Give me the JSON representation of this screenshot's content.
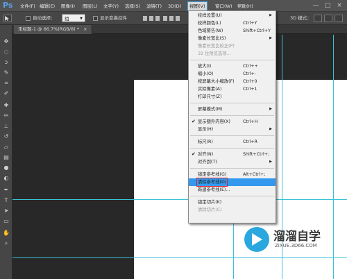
{
  "app": {
    "logo": "Ps"
  },
  "menubar": {
    "items": [
      "文件(F)",
      "编辑(E)",
      "图像(I)",
      "图层(L)",
      "文字(Y)",
      "选择(S)",
      "滤镜(T)",
      "3D(D)",
      "视图(V)",
      "窗口(W)",
      "帮助(H)"
    ],
    "active_index": 8
  },
  "options_bar": {
    "auto_select_label": "自动选择：",
    "auto_select_value": "组",
    "show_transform_label": "显示变换控件",
    "mode_3d_label": "3D 模式："
  },
  "document_tab": {
    "title": "未标题-1 @ 66.7%(RGB/8) *",
    "close": "×"
  },
  "window_controls": [
    "—",
    "□",
    "×"
  ],
  "view_menu": {
    "items": [
      {
        "label": "校样设置(U)",
        "shortcut": "",
        "submenu": true,
        "disabled": false
      },
      {
        "label": "校样颜色(L)",
        "shortcut": "Ctrl+Y",
        "submenu": false,
        "disabled": false
      },
      {
        "label": "色域警告(W)",
        "shortcut": "Shift+Ctrl+Y",
        "submenu": false,
        "disabled": false
      },
      {
        "label": "像素长宽比(S)",
        "shortcut": "",
        "submenu": true,
        "disabled": false
      },
      {
        "label": "像素长宽比校正(P)",
        "shortcut": "",
        "submenu": false,
        "disabled": true
      },
      {
        "label": "32 位预览选项...",
        "shortcut": "",
        "submenu": false,
        "disabled": true
      },
      {
        "label": "放大(I)",
        "shortcut": "Ctrl++",
        "submenu": false,
        "disabled": false
      },
      {
        "label": "缩小(O)",
        "shortcut": "Ctrl+-",
        "submenu": false,
        "disabled": false
      },
      {
        "label": "按屏幕大小缩放(F)",
        "shortcut": "Ctrl+0",
        "submenu": false,
        "disabled": false
      },
      {
        "label": "实际像素(A)",
        "shortcut": "Ctrl+1",
        "submenu": false,
        "disabled": false
      },
      {
        "label": "打印尺寸(Z)",
        "shortcut": "",
        "submenu": false,
        "disabled": false
      },
      {
        "label": "屏幕模式(M)",
        "shortcut": "",
        "submenu": true,
        "disabled": false
      },
      {
        "label": "显示额外内容(X)",
        "shortcut": "Ctrl+H",
        "submenu": false,
        "disabled": false,
        "checked": true
      },
      {
        "label": "显示(H)",
        "shortcut": "",
        "submenu": true,
        "disabled": false
      },
      {
        "label": "标尺(R)",
        "shortcut": "Ctrl+R",
        "submenu": false,
        "disabled": false
      },
      {
        "label": "对齐(N)",
        "shortcut": "Shift+Ctrl+;",
        "submenu": false,
        "disabled": false,
        "checked": true
      },
      {
        "label": "对齐到(T)",
        "shortcut": "",
        "submenu": true,
        "disabled": false
      },
      {
        "label": "锁定参考线(G)",
        "shortcut": "Alt+Ctrl+;",
        "submenu": false,
        "disabled": false
      },
      {
        "label": "清除参考线(D)",
        "shortcut": "",
        "submenu": false,
        "disabled": false,
        "highlighted": true
      },
      {
        "label": "新建参考线(E)...",
        "shortcut": "",
        "submenu": false,
        "disabled": false
      },
      {
        "label": "锁定切片(K)",
        "shortcut": "",
        "submenu": false,
        "disabled": false
      },
      {
        "label": "清除切片(C)",
        "shortcut": "",
        "submenu": false,
        "disabled": true
      }
    ]
  },
  "watermark": {
    "title": "溜溜自学",
    "url": "ZIXUE.3D66.COM"
  },
  "colors": {
    "accent": "#3399ee",
    "guide": "#36c3d8",
    "highlight_border": "#e0202f"
  }
}
